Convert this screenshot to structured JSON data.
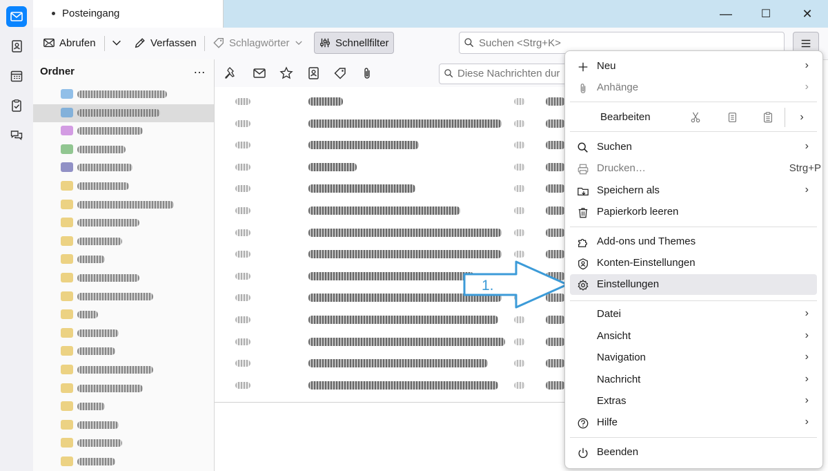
{
  "tab": {
    "title": "Posteingang"
  },
  "window_controls": {
    "minimize": "—",
    "maximize": "☐",
    "close": "✕"
  },
  "toolbar": {
    "fetch_label": "Abrufen",
    "compose_label": "Verfassen",
    "tags_label": "Schlagwörter",
    "quickfilter_label": "Schnellfilter",
    "search_placeholder": "Suchen <Strg+K>"
  },
  "folder_pane": {
    "title": "Ordner",
    "menu_label": "…"
  },
  "message_list": {
    "filter_placeholder": "Diese Nachrichten dur"
  },
  "app_menu": {
    "new": "Neu",
    "attachments": "Anhänge",
    "edit": "Bearbeiten",
    "search": "Suchen",
    "print": "Drucken…",
    "print_shortcut": "Strg+P",
    "save_as": "Speichern als",
    "empty_trash": "Papierkorb leeren",
    "addons": "Add-ons und Themes",
    "account_settings": "Konten-Einstellungen",
    "settings": "Einstellungen",
    "file": "Datei",
    "view": "Ansicht",
    "navigation": "Navigation",
    "message": "Nachricht",
    "extras": "Extras",
    "help": "Hilfe",
    "quit": "Beenden"
  },
  "annotation": {
    "step": "1.",
    "color": "#3c9bd8"
  },
  "colors": {
    "accent": "#0a84ff",
    "titlebar": "#c9e3f2"
  }
}
